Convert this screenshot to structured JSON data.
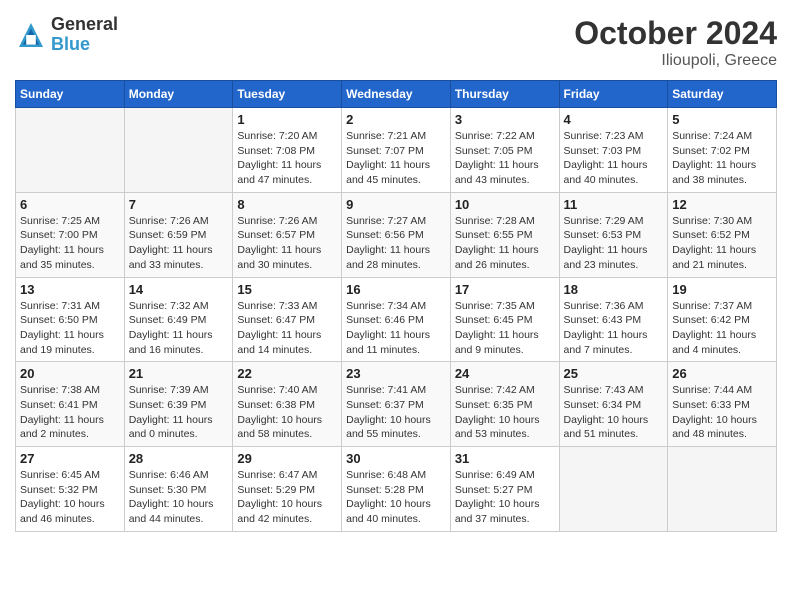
{
  "logo": {
    "line1": "General",
    "line2": "Blue"
  },
  "title": "October 2024",
  "subtitle": "Ilioupoli, Greece",
  "weekdays": [
    "Sunday",
    "Monday",
    "Tuesday",
    "Wednesday",
    "Thursday",
    "Friday",
    "Saturday"
  ],
  "weeks": [
    [
      {
        "day": "",
        "info": ""
      },
      {
        "day": "",
        "info": ""
      },
      {
        "day": "1",
        "info": "Sunrise: 7:20 AM\nSunset: 7:08 PM\nDaylight: 11 hours and 47 minutes."
      },
      {
        "day": "2",
        "info": "Sunrise: 7:21 AM\nSunset: 7:07 PM\nDaylight: 11 hours and 45 minutes."
      },
      {
        "day": "3",
        "info": "Sunrise: 7:22 AM\nSunset: 7:05 PM\nDaylight: 11 hours and 43 minutes."
      },
      {
        "day": "4",
        "info": "Sunrise: 7:23 AM\nSunset: 7:03 PM\nDaylight: 11 hours and 40 minutes."
      },
      {
        "day": "5",
        "info": "Sunrise: 7:24 AM\nSunset: 7:02 PM\nDaylight: 11 hours and 38 minutes."
      }
    ],
    [
      {
        "day": "6",
        "info": "Sunrise: 7:25 AM\nSunset: 7:00 PM\nDaylight: 11 hours and 35 minutes."
      },
      {
        "day": "7",
        "info": "Sunrise: 7:26 AM\nSunset: 6:59 PM\nDaylight: 11 hours and 33 minutes."
      },
      {
        "day": "8",
        "info": "Sunrise: 7:26 AM\nSunset: 6:57 PM\nDaylight: 11 hours and 30 minutes."
      },
      {
        "day": "9",
        "info": "Sunrise: 7:27 AM\nSunset: 6:56 PM\nDaylight: 11 hours and 28 minutes."
      },
      {
        "day": "10",
        "info": "Sunrise: 7:28 AM\nSunset: 6:55 PM\nDaylight: 11 hours and 26 minutes."
      },
      {
        "day": "11",
        "info": "Sunrise: 7:29 AM\nSunset: 6:53 PM\nDaylight: 11 hours and 23 minutes."
      },
      {
        "day": "12",
        "info": "Sunrise: 7:30 AM\nSunset: 6:52 PM\nDaylight: 11 hours and 21 minutes."
      }
    ],
    [
      {
        "day": "13",
        "info": "Sunrise: 7:31 AM\nSunset: 6:50 PM\nDaylight: 11 hours and 19 minutes."
      },
      {
        "day": "14",
        "info": "Sunrise: 7:32 AM\nSunset: 6:49 PM\nDaylight: 11 hours and 16 minutes."
      },
      {
        "day": "15",
        "info": "Sunrise: 7:33 AM\nSunset: 6:47 PM\nDaylight: 11 hours and 14 minutes."
      },
      {
        "day": "16",
        "info": "Sunrise: 7:34 AM\nSunset: 6:46 PM\nDaylight: 11 hours and 11 minutes."
      },
      {
        "day": "17",
        "info": "Sunrise: 7:35 AM\nSunset: 6:45 PM\nDaylight: 11 hours and 9 minutes."
      },
      {
        "day": "18",
        "info": "Sunrise: 7:36 AM\nSunset: 6:43 PM\nDaylight: 11 hours and 7 minutes."
      },
      {
        "day": "19",
        "info": "Sunrise: 7:37 AM\nSunset: 6:42 PM\nDaylight: 11 hours and 4 minutes."
      }
    ],
    [
      {
        "day": "20",
        "info": "Sunrise: 7:38 AM\nSunset: 6:41 PM\nDaylight: 11 hours and 2 minutes."
      },
      {
        "day": "21",
        "info": "Sunrise: 7:39 AM\nSunset: 6:39 PM\nDaylight: 11 hours and 0 minutes."
      },
      {
        "day": "22",
        "info": "Sunrise: 7:40 AM\nSunset: 6:38 PM\nDaylight: 10 hours and 58 minutes."
      },
      {
        "day": "23",
        "info": "Sunrise: 7:41 AM\nSunset: 6:37 PM\nDaylight: 10 hours and 55 minutes."
      },
      {
        "day": "24",
        "info": "Sunrise: 7:42 AM\nSunset: 6:35 PM\nDaylight: 10 hours and 53 minutes."
      },
      {
        "day": "25",
        "info": "Sunrise: 7:43 AM\nSunset: 6:34 PM\nDaylight: 10 hours and 51 minutes."
      },
      {
        "day": "26",
        "info": "Sunrise: 7:44 AM\nSunset: 6:33 PM\nDaylight: 10 hours and 48 minutes."
      }
    ],
    [
      {
        "day": "27",
        "info": "Sunrise: 6:45 AM\nSunset: 5:32 PM\nDaylight: 10 hours and 46 minutes."
      },
      {
        "day": "28",
        "info": "Sunrise: 6:46 AM\nSunset: 5:30 PM\nDaylight: 10 hours and 44 minutes."
      },
      {
        "day": "29",
        "info": "Sunrise: 6:47 AM\nSunset: 5:29 PM\nDaylight: 10 hours and 42 minutes."
      },
      {
        "day": "30",
        "info": "Sunrise: 6:48 AM\nSunset: 5:28 PM\nDaylight: 10 hours and 40 minutes."
      },
      {
        "day": "31",
        "info": "Sunrise: 6:49 AM\nSunset: 5:27 PM\nDaylight: 10 hours and 37 minutes."
      },
      {
        "day": "",
        "info": ""
      },
      {
        "day": "",
        "info": ""
      }
    ]
  ]
}
